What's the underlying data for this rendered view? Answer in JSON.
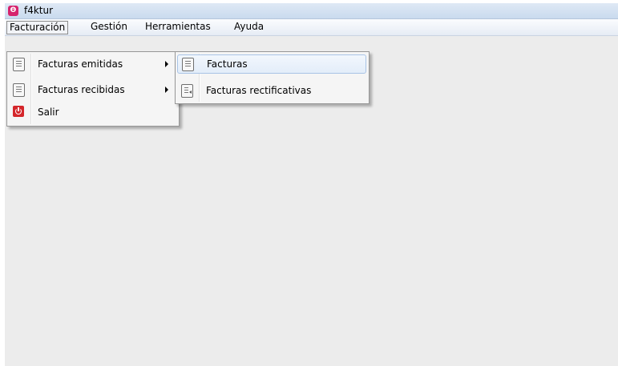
{
  "window": {
    "title": "f4ktur",
    "app_icon_glyph": "Θ",
    "accent": "#d6236d"
  },
  "menubar": {
    "items": [
      {
        "label": "Facturación"
      },
      {
        "label": "Gestión"
      },
      {
        "label": "Herramientas"
      },
      {
        "label": "Ayuda"
      }
    ]
  },
  "facturacion_menu": {
    "items": [
      {
        "label": "Facturas emitidas",
        "icon": "document-icon",
        "has_submenu": true
      },
      {
        "label": "Facturas recibidas",
        "icon": "document-icon",
        "has_submenu": true
      },
      {
        "label": "Salir",
        "icon": "power-icon",
        "has_submenu": false
      }
    ]
  },
  "emitidas_submenu": {
    "items": [
      {
        "label": "Facturas",
        "icon": "document-icon"
      },
      {
        "label": "Facturas rectificativas",
        "icon": "document-rectify-icon"
      }
    ]
  }
}
